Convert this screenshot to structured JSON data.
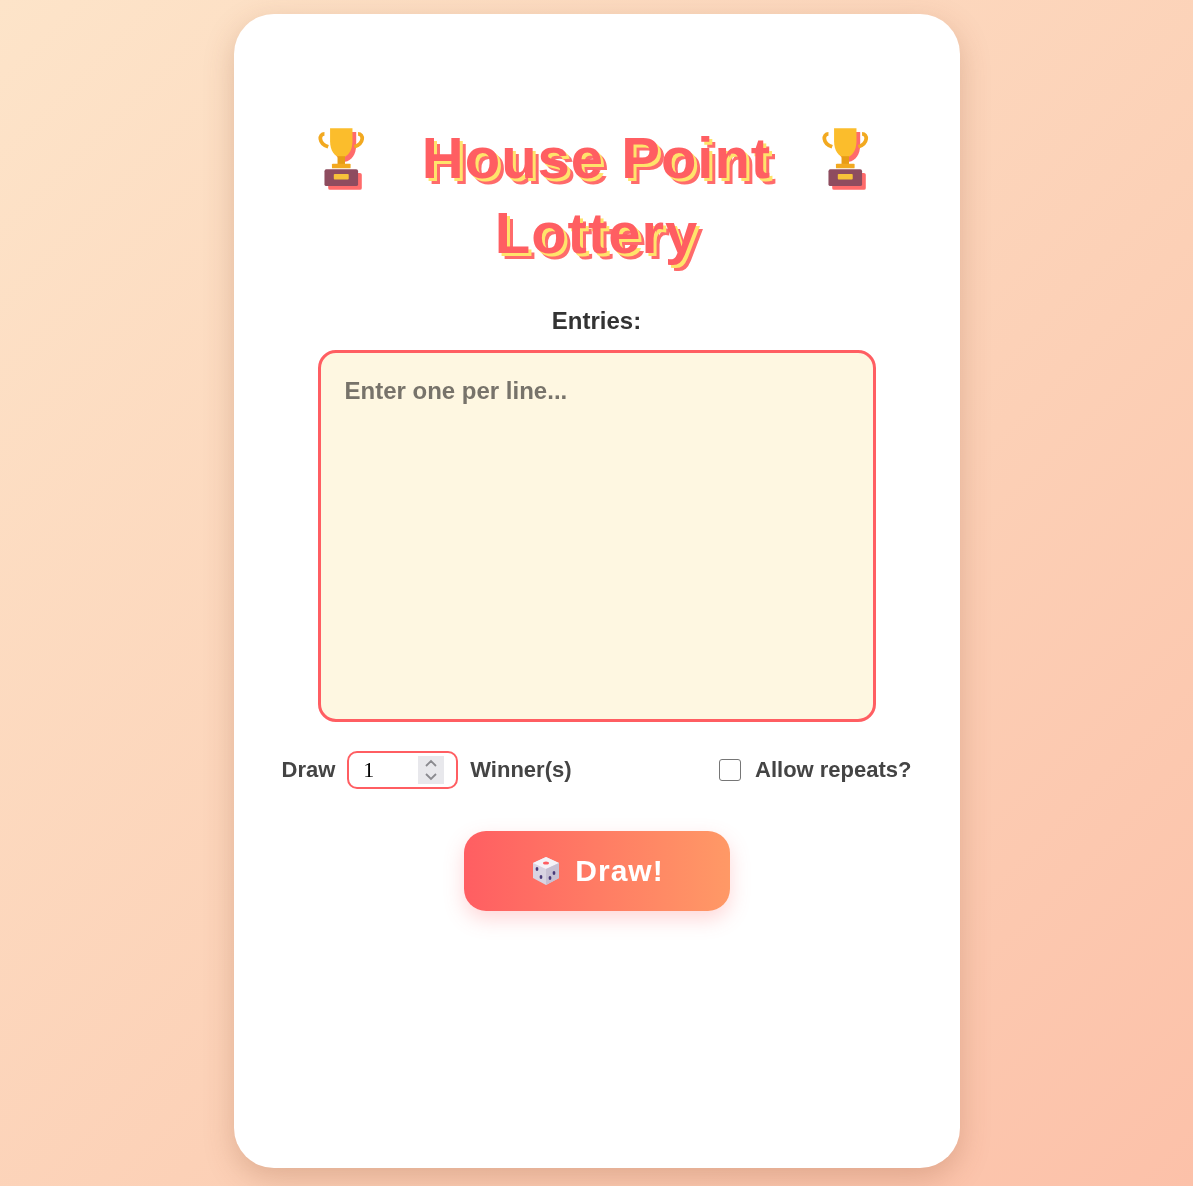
{
  "title": {
    "text": "House Point Lottery"
  },
  "entries": {
    "label": "Entries:",
    "placeholder": "Enter one per line..."
  },
  "draw_options": {
    "prefix": "Draw",
    "count": "1",
    "suffix": "Winner(s)",
    "allow_repeats": {
      "label": "Allow repeats?",
      "checked": false
    }
  },
  "draw_button": {
    "label": "Draw!"
  }
}
